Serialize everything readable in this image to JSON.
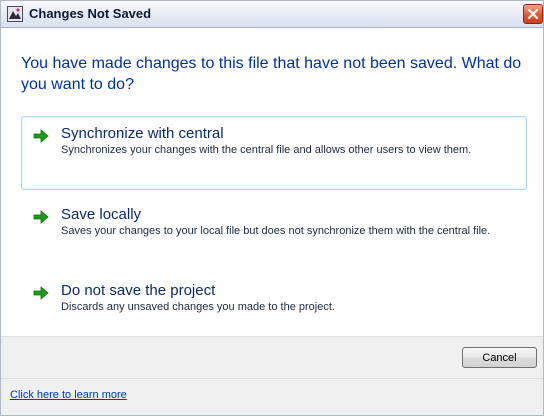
{
  "window": {
    "title": "Changes Not Saved",
    "app_icon": "app-icon",
    "close_icon": "close-icon"
  },
  "instruction": "You have made changes to this file that have not been saved. What do you want to do?",
  "options": [
    {
      "title": "Synchronize with central",
      "description": "Synchronizes your changes with the central file and allows other users to view them.",
      "icon": "green-arrow-icon",
      "selected": true
    },
    {
      "title": "Save locally",
      "description": "Saves your changes to your local file but does not synchronize them with the central file.",
      "icon": "green-arrow-icon",
      "selected": false
    },
    {
      "title": "Do not save the project",
      "description": "Discards any unsaved changes you made to the project.",
      "icon": "green-arrow-icon",
      "selected": false
    }
  ],
  "buttons": {
    "cancel": "Cancel"
  },
  "footer": {
    "link": "Click here to learn more"
  },
  "colors": {
    "instruction": "#003399",
    "arrow": "#1e9a1e",
    "selected_border": "#a7d9e8",
    "close_button": "#de5a38"
  }
}
